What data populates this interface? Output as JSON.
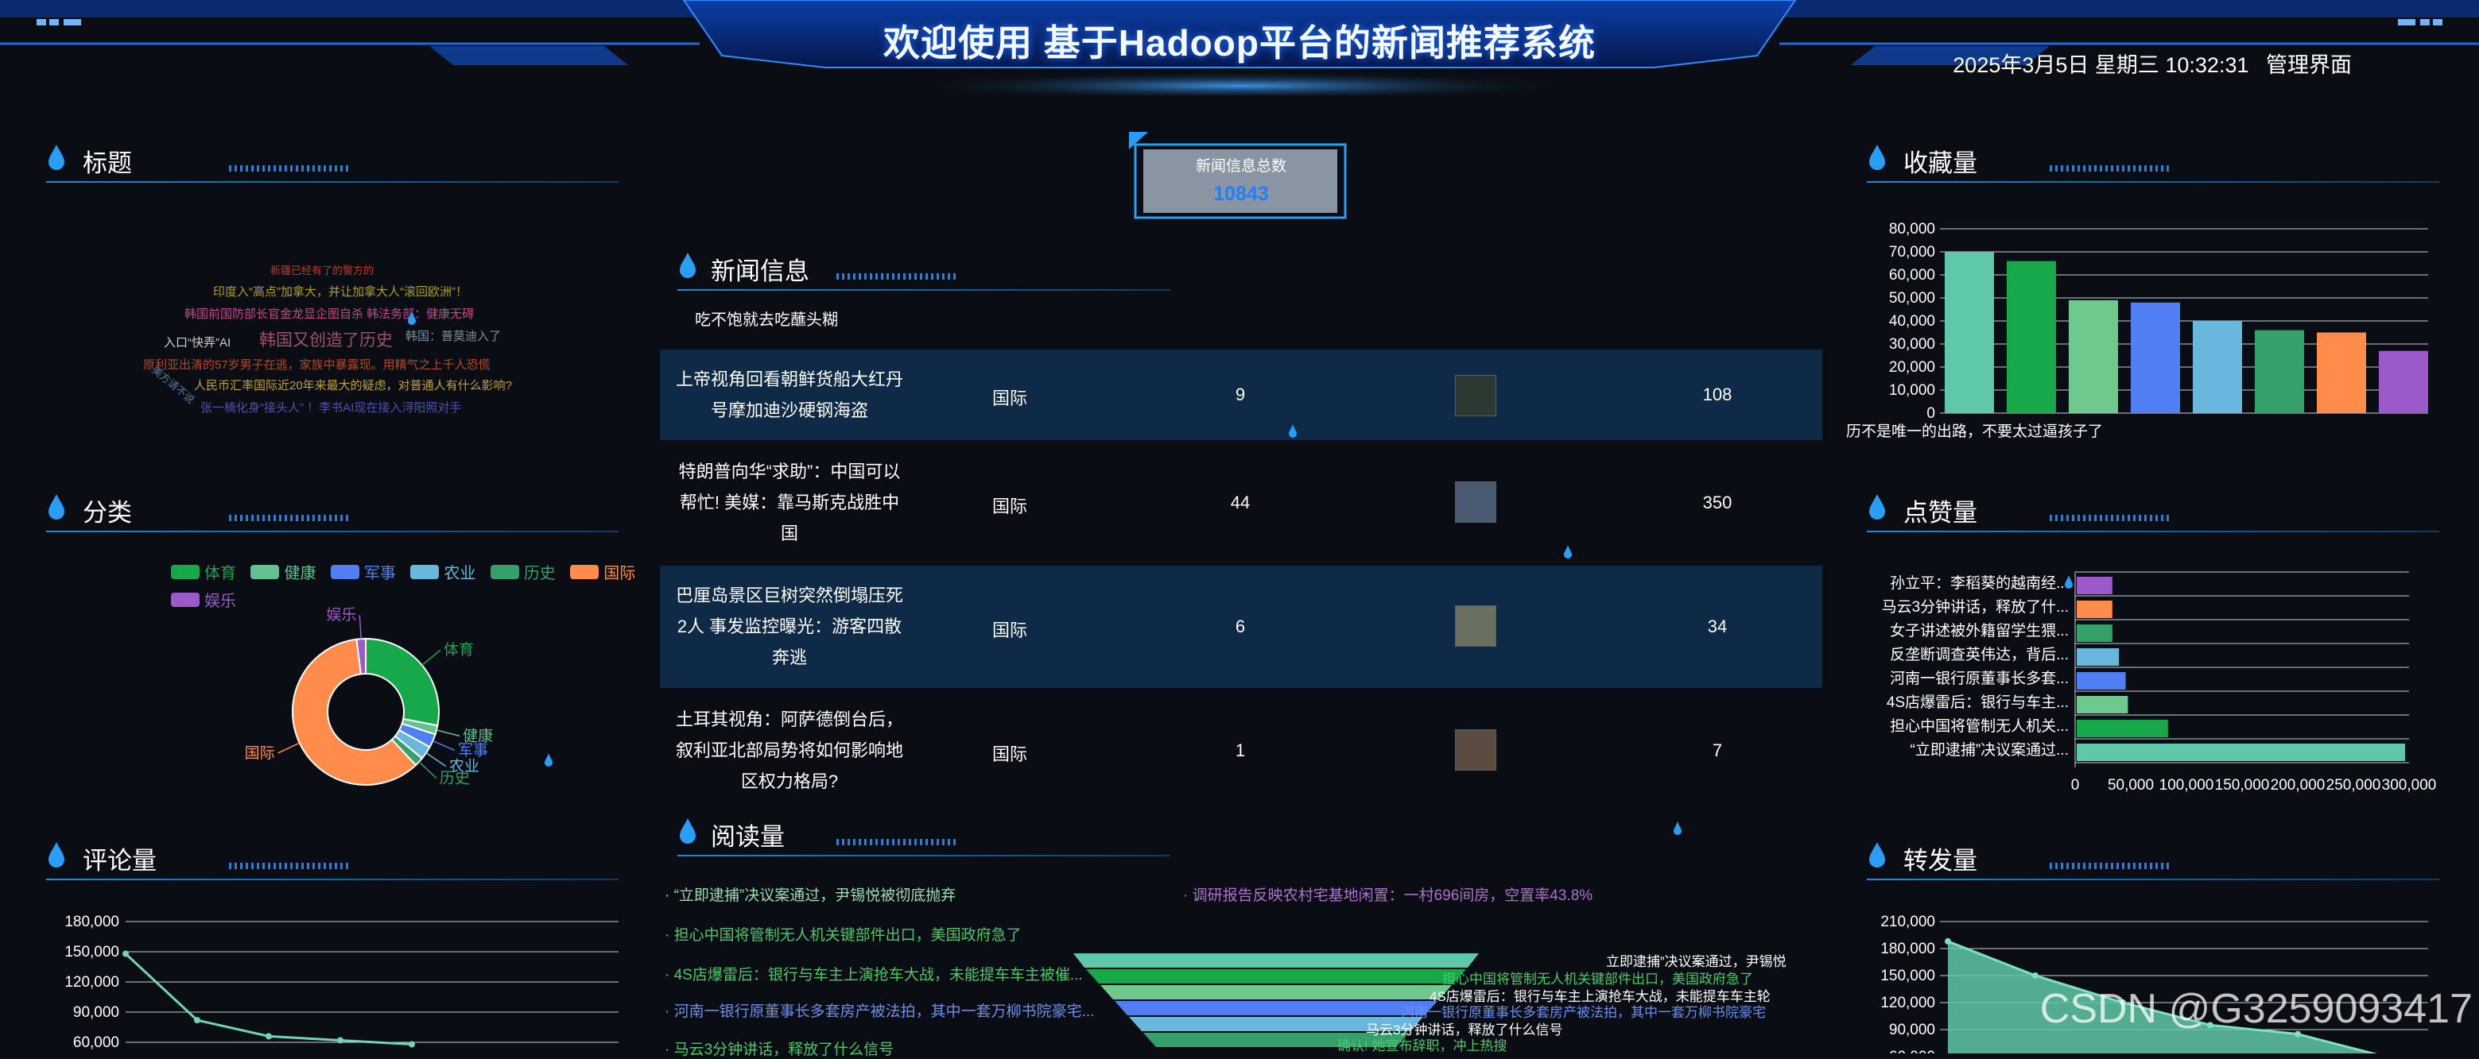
{
  "header": {
    "title": "欢迎使用 基于Hadoop平台的新闻推荐系统",
    "datetime": "2025年3月5日 星期三 10:32:31",
    "admin_label": "管理界面"
  },
  "colors": {
    "background": "#0a0e14",
    "accent": "#1f8ad8",
    "row_highlight": "#0f2a47"
  },
  "panels": {
    "title_cloud": "标题",
    "category": "分类",
    "comments": "评论量",
    "news_info": "新闻信息",
    "reads": "阅读量",
    "favorites": "收藏量",
    "likes": "点赞量",
    "shares": "转发量"
  },
  "word_cloud": [
    {
      "text": "新疆已经有了的警方的",
      "color": "#c0392b"
    },
    {
      "text": "印度入“高点”加拿大，并让加拿大人“滚回欧洲”！",
      "color": "#b0a020"
    },
    {
      "text": "韩国前国防部长官金龙显企图自杀 韩法务部：健康无碍",
      "color": "#c24a8a"
    },
    {
      "text": "入口“快弄”AI",
      "color": "#cfcfcf"
    },
    {
      "text": "韩国又创造了历史",
      "color": "#a0506a"
    },
    {
      "text": "韩国：普莫迪入了",
      "color": "#7a8fa0"
    },
    {
      "text": "原利亚出清的57岁男子在逃，家族中暴露现。用精气之上千人恐慌",
      "color": "#b04a2a"
    },
    {
      "text": "人民币汇率国际近20年来最大的疑虑，对普通人有什么影响?",
      "color": "#c0a030"
    },
    {
      "text": "美方请不说",
      "color": "#5a7aa0"
    },
    {
      "text": "张一楠化身“接头人” ！李书AI现在接入浔阳照对手",
      "color": "#5050b0"
    }
  ],
  "category_chart": {
    "legend": [
      "体育",
      "健康",
      "军事",
      "农业",
      "历史",
      "国际",
      "娱乐"
    ],
    "slices": [
      {
        "name": "体育",
        "value": 28,
        "color": "#17a84a"
      },
      {
        "name": "健康",
        "value": 2,
        "color": "#5fc28f"
      },
      {
        "name": "军事",
        "value": 3,
        "color": "#4f7ff2"
      },
      {
        "name": "农业",
        "value": 3,
        "color": "#68b8dd"
      },
      {
        "name": "历史",
        "value": 2,
        "color": "#35a06a"
      },
      {
        "name": "国际",
        "value": 60,
        "color": "#ff8c4a"
      },
      {
        "name": "娱乐",
        "value": 2,
        "color": "#9b59c9"
      }
    ]
  },
  "comments_chart": {
    "type": "line",
    "ticks": [
      "180,000",
      "150,000",
      "120,000",
      "90,000",
      "60,000"
    ],
    "ylim": [
      60000,
      180000
    ],
    "values": [
      148000,
      82000,
      66000,
      62000,
      58000
    ]
  },
  "news_total": {
    "label": "新闻信息总数",
    "value": "10843"
  },
  "news_info": {
    "header_title": "吃不饱就去吃蘸头糊",
    "rows": [
      {
        "title": "上帝视角回看朝鲜货船大红丹号摩加迪沙硬钢海盗",
        "category": "国际",
        "count1": "9",
        "count2": "108"
      },
      {
        "title": "特朗普向华“求助”：中国可以帮忙! 美媒：靠马斯克战胜中国",
        "category": "国际",
        "count1": "44",
        "count2": "350"
      },
      {
        "title": "巴厘岛景区巨树突然倒塌压死2人 事发监控曝光：游客四散奔逃",
        "category": "国际",
        "count1": "6",
        "count2": "34"
      },
      {
        "title": "土耳其视角：阿萨德倒台后，叙利亚北部局势将如何影响地区权力格局?",
        "category": "国际",
        "count1": "1",
        "count2": "7"
      }
    ]
  },
  "reads": {
    "list_left": [
      {
        "text": "“立即逮捕”决议案通过，尹锡悦被彻底抛弃",
        "color": "#9adfb0"
      },
      {
        "text": "担心中国将管制无人机关键部件出口，美国政府急了",
        "color": "#4ac96a"
      },
      {
        "text": "4S店爆雷后：银行与车主上演抢车大战，未能提车车主被催...",
        "color": "#4ac96a"
      },
      {
        "text": "河南一银行原董事长多套房产被法拍，其中一套万柳书院豪宅...",
        "color": "#6a8ff0"
      },
      {
        "text": "马云3分钟讲话，释放了什么信号",
        "color": "#4ac96a"
      }
    ],
    "list_right": [
      {
        "text": "调研报告反映农村宅基地闲置：一村696间房，空置率43.8%",
        "color": "#b070d0"
      }
    ],
    "funnel_labels": [
      {
        "text": "立即逮捕”决议案通过，尹锡悦",
        "color": "#ffffff"
      },
      {
        "text": "担心中国将管制无人机关键部件出口，美国政府急了",
        "color": "#4ac96a"
      },
      {
        "text": "4S店爆雷后：银行与车主上演抢车大战，未能提车车主轮",
        "color": "#ffffff"
      },
      {
        "text": "河南一银行原董事长多套房产被法拍，其中一套万柳书院豪宅",
        "color": "#6a8ff0"
      },
      {
        "text": "马云3分钟讲话，释放了什么信号",
        "color": "#ffffff"
      },
      {
        "text": "确认! 她宣布辞职，冲上热搜",
        "color": "#4ac96a"
      }
    ]
  },
  "favorites_chart": {
    "type": "bar",
    "ticks": [
      "80,000",
      "70,000",
      "60,000",
      "50,000",
      "40,000",
      "30,000",
      "20,000",
      "10,000",
      "0"
    ],
    "ylim": [
      0,
      80000
    ],
    "values": [
      70000,
      66000,
      49000,
      48000,
      40000,
      36000,
      35000,
      27000
    ],
    "colors": [
      "#5fc8a8",
      "#17a84a",
      "#6fc98f",
      "#4f7ff2",
      "#68b8dd",
      "#35a06a",
      "#ff8c4a",
      "#9b59c9"
    ],
    "caption": "历不是唯一的出路，不要太过逼孩子了"
  },
  "likes_chart": {
    "type": "bar",
    "categories": [
      "孙立平：李稻葵的越南经...",
      "马云3分钟讲话，释放了什...",
      "女子讲述被外籍留学生猥...",
      "反垄断调查英伟达，背后...",
      "河南一银行原董事长多套...",
      "4S店爆雷后：银行与车主...",
      "担心中国将管制无人机关...",
      "“立即逮捕”决议案通过..."
    ],
    "values": [
      32000,
      32000,
      32000,
      38000,
      44000,
      46000,
      82000,
      295000
    ],
    "colors": [
      "#9b59c9",
      "#ff8c4a",
      "#35a06a",
      "#68b8dd",
      "#4f7ff2",
      "#6fc98f",
      "#17a84a",
      "#5fc8a8"
    ],
    "ticks": [
      "0",
      "50,000",
      "100,000",
      "150,000",
      "200,000",
      "250,000",
      "300,000"
    ],
    "xlim": [
      0,
      300000
    ]
  },
  "shares_chart": {
    "type": "area",
    "ticks": [
      "210,000",
      "180,000",
      "150,000",
      "120,000",
      "90,000",
      "60,000"
    ],
    "ylim": [
      60000,
      210000
    ],
    "values": [
      188000,
      150000,
      120000,
      95000,
      85000,
      60000
    ]
  },
  "watermark": "CSDN @G3259093417"
}
